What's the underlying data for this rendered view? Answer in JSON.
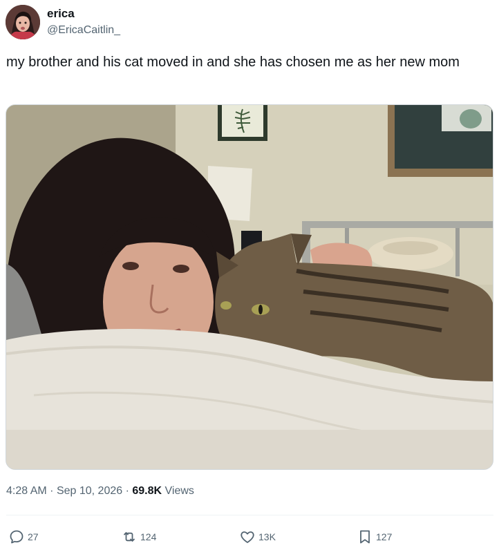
{
  "author": {
    "name": "erica",
    "handle": "@EricaCaitlin_"
  },
  "tweet": {
    "text": "my brother and his cat moved in and she has chosen me as her new mom"
  },
  "media": {
    "description_icon": "photo-woman-with-tabby-cat"
  },
  "meta": {
    "time": "4:28 AM",
    "separator": "·",
    "date": "Sep 10, 2026",
    "views_count": "69.8K",
    "views_label": "Views"
  },
  "actions": {
    "replies": "27",
    "retweets": "124",
    "likes": "13K",
    "bookmarks": "127"
  },
  "colors": {
    "text_primary": "#0f1419",
    "text_secondary": "#536471",
    "divider": "#eff3f4"
  }
}
